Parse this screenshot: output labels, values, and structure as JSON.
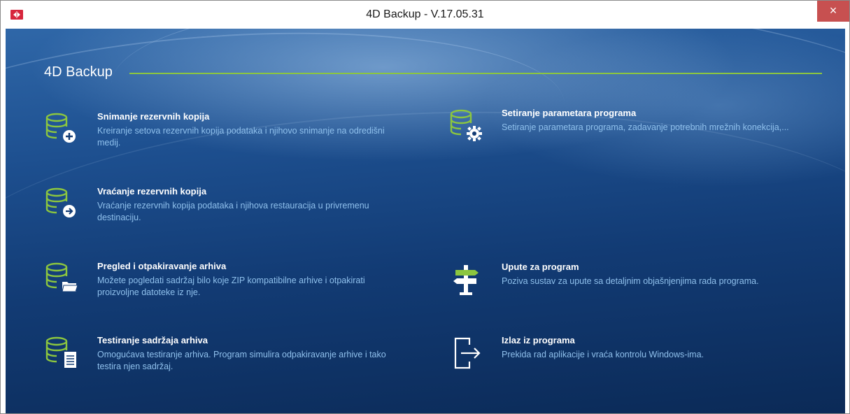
{
  "window": {
    "title": "4D Backup - V.17.05.31",
    "close_glyph": "×"
  },
  "header": {
    "title": "4D Backup"
  },
  "menu": [
    {
      "title": "Snimanje rezervnih kopija",
      "description": "Kreiranje setova rezervnih kopija podataka i njihovo snimanje na odredišni medij.",
      "icon": "database-plus-icon"
    },
    {
      "title": "Setiranje parametara programa",
      "description": "Setiranje parametara programa, zadavanje potrebnih mrežnih konekcija,...",
      "icon": "database-gear-icon"
    },
    {
      "title": "Vraćanje rezervnih kopija",
      "description": "Vraćanje rezervnih kopija podataka i njihova restauracija u privremenu destinaciju.",
      "icon": "database-arrow-icon"
    },
    {
      "title": "Pregled i otpakiravanje arhiva",
      "description": "Možete pogledati sadržaj bilo koje ZIP kompatibilne arhive i otpakirati proizvoljne datoteke iz nje.",
      "icon": "database-folder-icon"
    },
    {
      "title": "Upute za program",
      "description": "Poziva sustav za upute sa detaljnim objašnjenjima rada programa.",
      "icon": "signpost-icon"
    },
    {
      "title": "Testiranje sadržaja arhiva",
      "description": "Omogućava testiranje arhiva. Program simulira odpakiravanje arhive i tako testira njen sadržaj.",
      "icon": "database-document-icon"
    },
    {
      "title": "Izlaz iz programa",
      "description": "Prekida rad aplikacije i vraća kontrolu Windows-ima.",
      "icon": "exit-icon"
    }
  ],
  "colors": {
    "accent_green": "#8cc63f",
    "title_text": "#ffffff",
    "description_text": "#8fc0ec",
    "background_dark": "#0b2a57",
    "close_button": "#c75050"
  }
}
